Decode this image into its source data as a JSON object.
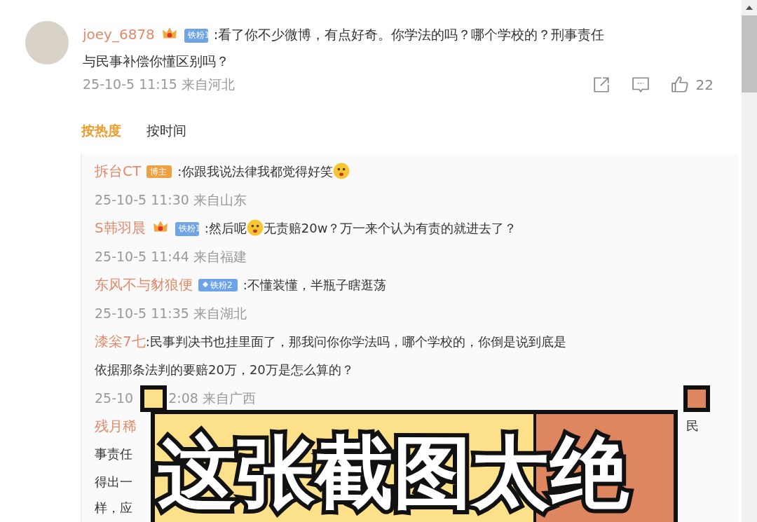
{
  "comment": {
    "user": "joey_6878",
    "badge": {
      "kind": "crown",
      "label": "铁粉1"
    },
    "text_lines": [
      ":看了你不少微博，有点好奇。你学法的吗？哪个学校的？刑事责任",
      "与民事补偿你懂区别吗？"
    ],
    "time": "25-10-5 11:15 来自河北",
    "likes": "22"
  },
  "sort_tabs": [
    {
      "label": "按热度",
      "selected": true
    },
    {
      "label": "按时间",
      "selected": false
    }
  ],
  "replies": [
    {
      "user": "拆台CT",
      "badge": {
        "kind": "author",
        "label": "博主"
      },
      "segments": [
        {
          "kind": "text",
          "text": ":你跟我说法律我都觉得好笑"
        },
        {
          "kind": "emoji"
        }
      ],
      "time": "25-10-5 11:30 来自山东"
    },
    {
      "user": "S韩羽晨",
      "badge": {
        "kind": "crown",
        "label": "铁粉1"
      },
      "segments": [
        {
          "kind": "text",
          "text": ":然后呢"
        },
        {
          "kind": "emoji"
        },
        {
          "kind": "text",
          "text": "无责赔20w？万一来个认为有责的就进去了？"
        }
      ],
      "time": "25-10-5 11:44 来自福建"
    },
    {
      "user": "东风不与豺狼便",
      "badge": {
        "kind": "diamond",
        "label": "铁粉2"
      },
      "segments": [
        {
          "kind": "text",
          "text": ":不懂装懂，半瓶子瞎逛荡"
        }
      ],
      "time": "25-10-5 11:35 来自湖北"
    },
    {
      "user": "漆枀7七",
      "segments": [
        {
          "kind": "text",
          "text": ":民事判决书也挂里面了，那我问你你学法吗，哪个学校的，你倒是说到底是"
        }
      ],
      "more_lines": [
        "依据那条法判的要赔20万，20万是怎么算的？"
      ],
      "time": "25-10",
      "time_rest": "2:08 来自广西"
    }
  ],
  "covered_reply": {
    "user": "残月稀",
    "lines": [
      "事责任",
      "得出一",
      "样，应"
    ],
    "right_fragment": "民"
  },
  "overlay": {
    "title": "这张截图太绝"
  }
}
